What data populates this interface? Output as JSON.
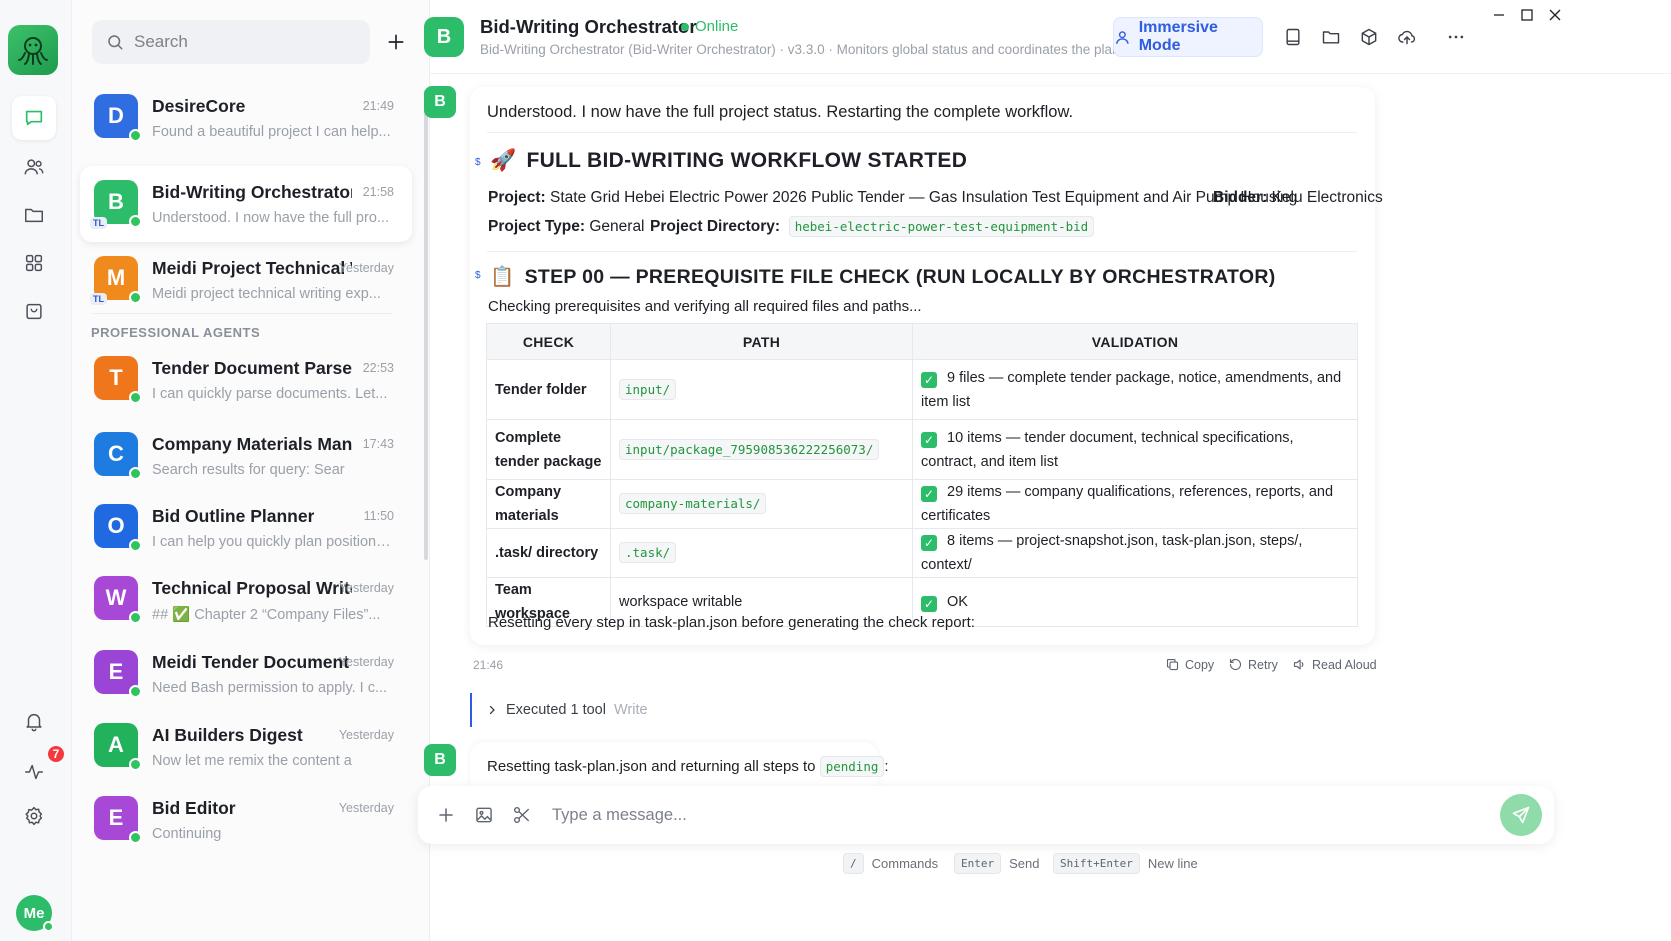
{
  "sidebar": {
    "search_placeholder": "Search",
    "section_label": "PROFESSIONAL AGENTS",
    "chats": [
      {
        "initial": "D",
        "color": "#2f6de0",
        "name": "DesireCore",
        "time": "21:49",
        "preview": "Found a beautiful project I can help..."
      },
      {
        "initial": "B",
        "color": "#2dbd6a",
        "name": "Bid-Writing Orchestrator",
        "time": "21:58",
        "preview": "Understood. I now have the full pro...",
        "tag": "TL"
      },
      {
        "initial": "M",
        "color": "#f08a1c",
        "name": "Meidi Project Technical Writer",
        "time": "Yesterday",
        "preview": "Meidi project technical writing exp...",
        "tag": "TL"
      },
      {
        "initial": "T",
        "color": "#f0761c",
        "name": "Tender Document Parser",
        "time": "22:53",
        "preview": "I can quickly parse documents. Let..."
      },
      {
        "initial": "C",
        "color": "#1e7be0",
        "name": "Company Materials Manager",
        "time": "17:43",
        "preview": "Search results for query: Sear"
      },
      {
        "initial": "O",
        "color": "#1f6ae0",
        "name": "Bid Outline Planner",
        "time": "11:50",
        "preview": "I can help you quickly plan positions..."
      },
      {
        "initial": "W",
        "color": "#a848d6",
        "name": "Technical Proposal Writer",
        "time": "Yesterday",
        "preview": "## ✅ Chapter 2 “Company Files”..."
      },
      {
        "initial": "E",
        "color": "#9b45d6",
        "name": "Meidi Tender Document Parser",
        "time": "Yesterday",
        "preview": "Need Bash permission to apply. I c..."
      },
      {
        "initial": "A",
        "color": "#22b25c",
        "name": "AI Builders Digest",
        "time": "Yesterday",
        "preview": "Now let me remix the content a"
      },
      {
        "initial": "E",
        "color": "#a848d6",
        "name": "Bid Editor",
        "time": "Yesterday",
        "preview": "Continuing"
      }
    ]
  },
  "rail": {
    "notifications_count": "7",
    "me_label": "Me"
  },
  "header": {
    "avatar": "B",
    "title": "Bid-Writing Orchestrator",
    "status": "Online",
    "subtitle": "Bid-Writing Orchestrator (Bid-Writer Orchestrator)  ·  v3.3.0  ·  Monitors global status and coordinates the plan",
    "immersive_label": "Immersive Mode"
  },
  "message": {
    "avatar": "B",
    "intro": "Understood. I now have the full project status. Restarting the complete workflow.",
    "heading1": "FULL BID-WRITING WORKFLOW STARTED",
    "heading1_emoji": "🚀",
    "project_label": "Project:",
    "project_value": "State Grid Hebei Electric Power 2026 Public Tender — Gas Insulation Test Equipment and Air Pump Housing",
    "bidder_label": "Bidder:",
    "bidder_value": "Kelu Electronics",
    "type_label": "Project Type:",
    "type_value": "General",
    "dir_label": "Project Directory:",
    "dir_value": "hebei-electric-power-test-equipment-bid",
    "heading2": "STEP 00 — PREREQUISITE FILE CHECK (RUN LOCALLY BY ORCHESTRATOR)",
    "heading2_emoji": "📋",
    "checking": "Checking prerequisites and verifying all required files and paths...",
    "table": {
      "headers": [
        "CHECK",
        "PATH",
        "VALIDATION"
      ],
      "rows": [
        {
          "check": "Tender folder",
          "path": "input/",
          "path_code": true,
          "validation": "9 files — complete tender package, notice, amendments, and item list"
        },
        {
          "check": "Complete tender package",
          "path": "input/package_795908536222256073/",
          "path_code": true,
          "validation": "10 items — tender document, technical specifications, contract, and item list"
        },
        {
          "check": "Company materials",
          "path": "company-materials/",
          "path_code": true,
          "validation": "29 items — company qualifications, references, reports, and certificates"
        },
        {
          "check": ".task/ directory",
          "path": ".task/",
          "path_code": true,
          "validation": "8 items — project-snapshot.json, task-plan.json, steps/, context/"
        },
        {
          "check": "Team workspace",
          "path": "workspace writable",
          "path_code": false,
          "validation": "OK"
        }
      ]
    },
    "resetting": "Resetting every step in task-plan.json before generating the check report:",
    "time": "21:46",
    "copy_label": "Copy",
    "retry_label": "Retry",
    "read_aloud_label": "Read Aloud"
  },
  "tool": {
    "label": "Executed 1 tool",
    "name": "Write"
  },
  "message2": {
    "text_before": "Resetting task-plan.json and returning all steps to",
    "code": "pending",
    "text_after": ":"
  },
  "composer": {
    "placeholder": "Type a message...",
    "hint_commands_key": "/",
    "hint_commands": "Commands",
    "hint_send_key": "Enter",
    "hint_send": "Send",
    "hint_newline_key": "Shift+Enter",
    "hint_newline": "New line"
  },
  "colors": {
    "accent_green": "#2dbd6a",
    "accent_blue": "#2f5ce0",
    "badge_red": "#f5383b"
  }
}
